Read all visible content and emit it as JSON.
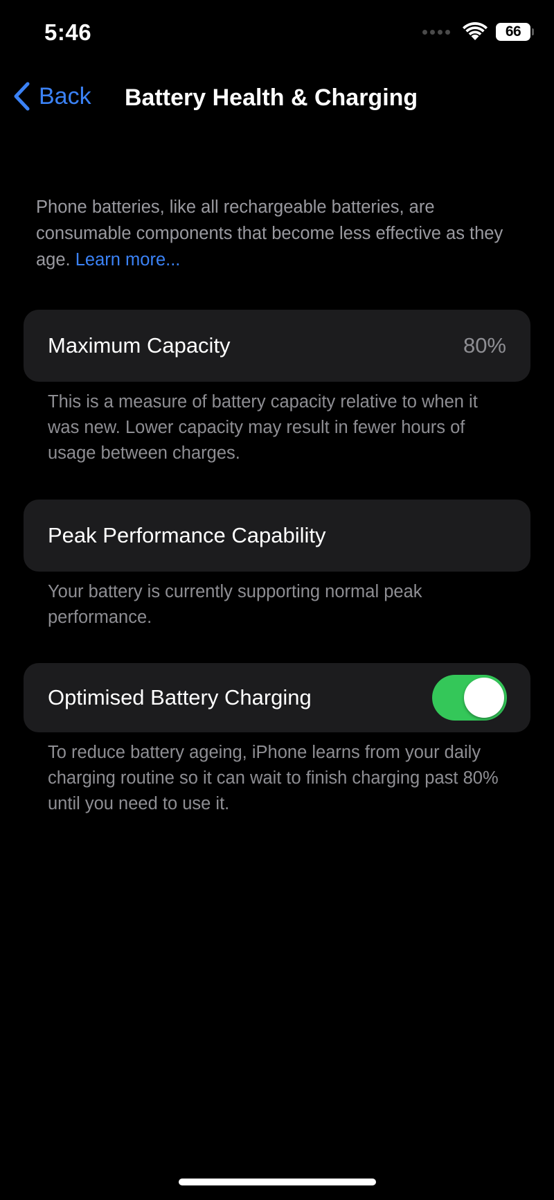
{
  "status_bar": {
    "time": "5:46",
    "battery_level": "66",
    "icons": [
      "signal-icon",
      "wifi-icon",
      "battery-icon"
    ]
  },
  "nav": {
    "back_label": "Back",
    "title": "Battery Health & Charging"
  },
  "intro": {
    "text": "Phone batteries, like all rechargeable batteries, are consumable components that become less effective as they age. ",
    "link": "Learn more..."
  },
  "maximum_capacity": {
    "label": "Maximum Capacity",
    "value": "80%",
    "note": "This is a measure of battery capacity relative to when it was new. Lower capacity may result in fewer hours of usage between charges."
  },
  "peak_performance": {
    "label": "Peak Performance Capability",
    "note": "Your battery is currently supporting normal peak performance."
  },
  "optimised_charging": {
    "label": "Optimised Battery Charging",
    "enabled": true,
    "note": "To reduce battery ageing, iPhone learns from your daily charging routine so it can wait to finish charging past 80% until you need to use it."
  },
  "colors": {
    "accent": "#3b82f6",
    "toggle_on": "#34c759",
    "card_background": "#1c1c1e",
    "secondary_text": "#8e8e93"
  }
}
